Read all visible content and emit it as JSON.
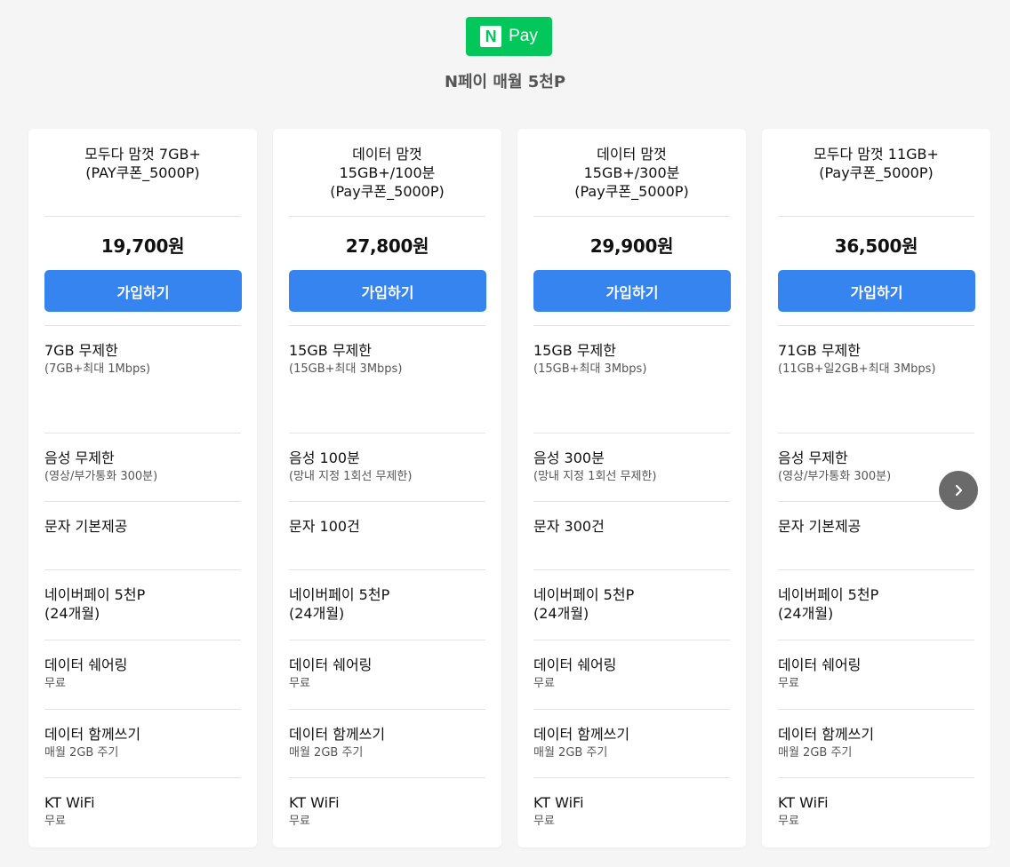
{
  "header": {
    "badge_n": "N",
    "badge_text": "Pay",
    "subtitle": "N페이 매월 5천P"
  },
  "colors": {
    "npay_green": "#03c75a",
    "button_blue": "#3584f0",
    "background": "#f5f5f5"
  },
  "cards": [
    {
      "title": "모두다 맘껏 7GB+\n(PAY쿠폰_5000P)",
      "price": "19,700원",
      "join_label": "가입하기",
      "features": [
        {
          "main": "7GB 무제한",
          "sub": "(7GB+최대 1Mbps)"
        },
        {
          "main": "음성 무제한",
          "sub": "(영상/부가통화 300분)"
        },
        {
          "main": "문자 기본제공",
          "sub": ""
        },
        {
          "main": "네이버페이 5천P\n(24개월)",
          "sub": ""
        },
        {
          "main": "데이터 쉐어링",
          "sub": "무료"
        },
        {
          "main": "데이터 함께쓰기",
          "sub": "매월 2GB 주기"
        },
        {
          "main": "KT WiFi",
          "sub": "무료"
        }
      ]
    },
    {
      "title": "데이터 맘껏\n15GB+/100분\n(Pay쿠폰_5000P)",
      "price": "27,800원",
      "join_label": "가입하기",
      "features": [
        {
          "main": "15GB 무제한",
          "sub": "(15GB+최대 3Mbps)"
        },
        {
          "main": "음성 100분",
          "sub": "(망내 지정 1회선 무제한)"
        },
        {
          "main": "문자 100건",
          "sub": ""
        },
        {
          "main": "네이버페이 5천P\n(24개월)",
          "sub": ""
        },
        {
          "main": "데이터 쉐어링",
          "sub": "무료"
        },
        {
          "main": "데이터 함께쓰기",
          "sub": "매월 2GB 주기"
        },
        {
          "main": "KT WiFi",
          "sub": "무료"
        }
      ]
    },
    {
      "title": "데이터 맘껏\n15GB+/300분\n(Pay쿠폰_5000P)",
      "price": "29,900원",
      "join_label": "가입하기",
      "features": [
        {
          "main": "15GB 무제한",
          "sub": "(15GB+최대 3Mbps)"
        },
        {
          "main": "음성 300분",
          "sub": "(망내 지정 1회선 무제한)"
        },
        {
          "main": "문자 300건",
          "sub": ""
        },
        {
          "main": "네이버페이 5천P\n(24개월)",
          "sub": ""
        },
        {
          "main": "데이터 쉐어링",
          "sub": "무료"
        },
        {
          "main": "데이터 함께쓰기",
          "sub": "매월 2GB 주기"
        },
        {
          "main": "KT WiFi",
          "sub": "무료"
        }
      ]
    },
    {
      "title": "모두다 맘껏 11GB+\n(Pay쿠폰_5000P)",
      "price": "36,500원",
      "join_label": "가입하기",
      "features": [
        {
          "main": "71GB 무제한",
          "sub": "(11GB+일2GB+최대 3Mbps)"
        },
        {
          "main": "음성 무제한",
          "sub": "(영상/부가통화 300분)"
        },
        {
          "main": "문자 기본제공",
          "sub": ""
        },
        {
          "main": "네이버페이 5천P\n(24개월)",
          "sub": ""
        },
        {
          "main": "데이터 쉐어링",
          "sub": "무료"
        },
        {
          "main": "데이터 함께쓰기",
          "sub": "매월 2GB 주기"
        },
        {
          "main": "KT WiFi",
          "sub": "무료"
        }
      ]
    }
  ],
  "next_icon": "chevron-right-icon"
}
